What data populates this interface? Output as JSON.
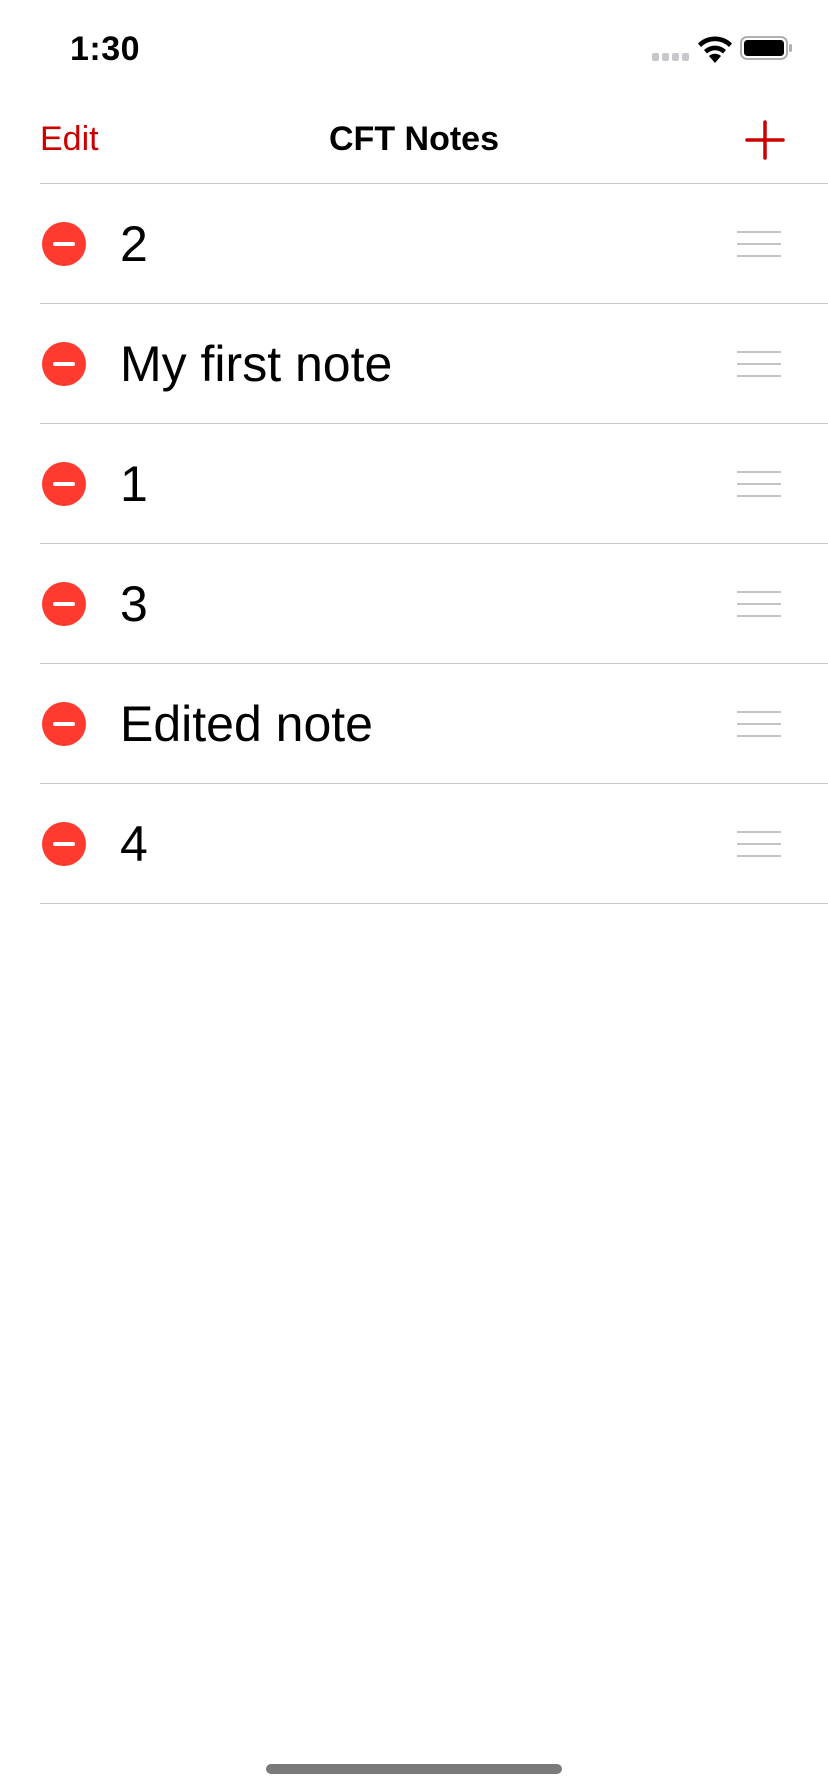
{
  "status_bar": {
    "time": "1:30",
    "icons": [
      "signal-icon",
      "wifi-icon",
      "battery-icon"
    ]
  },
  "nav_bar": {
    "edit_label": "Edit",
    "title": "CFT Notes",
    "add_icon": "plus-icon"
  },
  "notes": [
    {
      "title": "2"
    },
    {
      "title": "My first note"
    },
    {
      "title": "1"
    },
    {
      "title": "3"
    },
    {
      "title": "Edited note"
    },
    {
      "title": "4"
    }
  ],
  "row_icons": {
    "delete": "minus-circle-icon",
    "reorder": "reorder-handle-icon"
  },
  "colors": {
    "accent": "#cc0000",
    "delete_red": "#ff3b30",
    "separator": "#c8c7cc",
    "grip": "#c4c4c6"
  }
}
